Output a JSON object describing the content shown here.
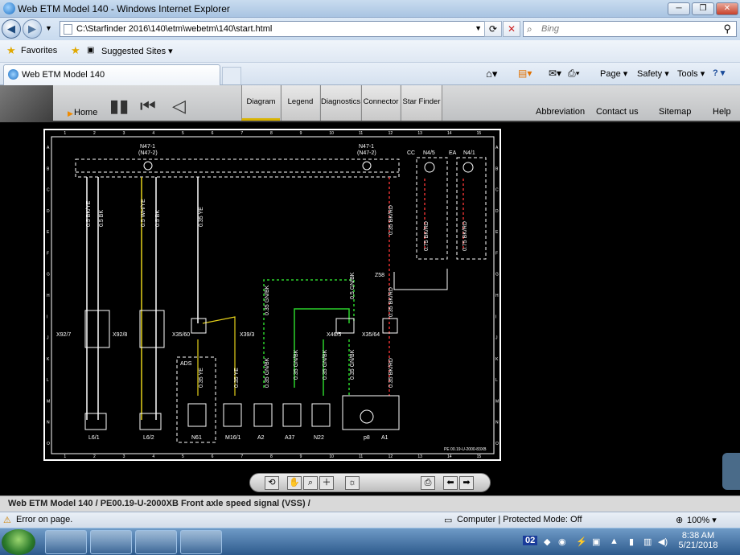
{
  "window": {
    "title": "Web ETM Model 140 - Windows Internet Explorer"
  },
  "address": {
    "url": "C:\\Starfinder 2016\\140\\etm\\webetm\\140\\start.html"
  },
  "search": {
    "placeholder": "Bing"
  },
  "favorites": {
    "label": "Favorites",
    "suggested": "Suggested Sites ▾"
  },
  "tab": {
    "label": "Web ETM Model 140"
  },
  "commandbar": {
    "page": "Page ▾",
    "safety": "Safety ▾",
    "tools": "Tools ▾",
    "help": "? ▾"
  },
  "app": {
    "home": "Home",
    "tabs": [
      "Diagram",
      "Legend",
      "Diagnostics",
      "Connector",
      "Star Finder"
    ],
    "links": {
      "abbreviation": "Abbreviation",
      "contact": "Contact us",
      "sitemap": "Sitemap",
      "help": "Help"
    }
  },
  "diagram": {
    "columns": [
      "1",
      "2",
      "3",
      "4",
      "5",
      "6",
      "7",
      "8",
      "9",
      "10",
      "11",
      "12",
      "13",
      "14",
      "15"
    ],
    "rows": [
      "A",
      "B",
      "C",
      "D",
      "E",
      "F",
      "G",
      "H",
      "I",
      "J",
      "K",
      "L",
      "M",
      "N",
      "O"
    ],
    "labels": {
      "n47_left": "N47-1",
      "n47_left2": "(N47-2)",
      "n47_right": "N47-1",
      "n47_right2": "(N47-2)",
      "cc": "CC",
      "n4_5": "N4/5",
      "ea": "EA",
      "n4_1": "N4/1",
      "z58": "Z58",
      "x92_7": "X92/7",
      "x92_8": "X92/8",
      "x35_60": "X35/60",
      "x39_3": "X39/3",
      "x46_5": "X46/5",
      "x35_64": "X35/64",
      "l6_1": "L6/1",
      "l6_2": "L6/2",
      "n61": "N61",
      "m16_1": "M16/1",
      "a2": "A2",
      "a37": "A37",
      "n22": "N22",
      "p8": "p8",
      "a1": "A1",
      "ads": "ADS",
      "docref": "PE 00.19-U-2000-83XB",
      "w1": "0.5 BK/YE",
      "w2": "0.5 BK",
      "w3": "0.5 WH/YE",
      "w4": "0.5 BK",
      "w5": "0.35 YE",
      "w6": "0.35 BK/RD",
      "w7": "0.75 BK/RD",
      "w8": "0.75 BK/RD",
      "w9": "0.35 GN/BK",
      "w10": "0.5 GN/BK",
      "w11": "0.35 BK/RD",
      "w12": "0.35 YE",
      "w13": "0.35 YE",
      "w14": "0.35 GN/BK",
      "w15": "0.35 GN/BK",
      "w16": "0.35 GN/BK",
      "w17": "0.35 GN/BK",
      "w18": "0.35 BK/RD"
    }
  },
  "docstatus": "Web ETM Model 140   / PE00.19-U-2000XB  Front axle speed signal (VSS) /",
  "iestatus": {
    "error": "Error on page.",
    "zone": "Computer | Protected Mode: Off",
    "zoom": "100% ▾"
  },
  "taskbar": {
    "time": "8:38 AM",
    "date": "5/21/2018",
    "lang": "02"
  },
  "colors": {
    "wire_green": "#2bd12b",
    "wire_red": "#e03030",
    "wire_yellow": "#e6d21a",
    "diagram_fg": "#ffffff"
  }
}
